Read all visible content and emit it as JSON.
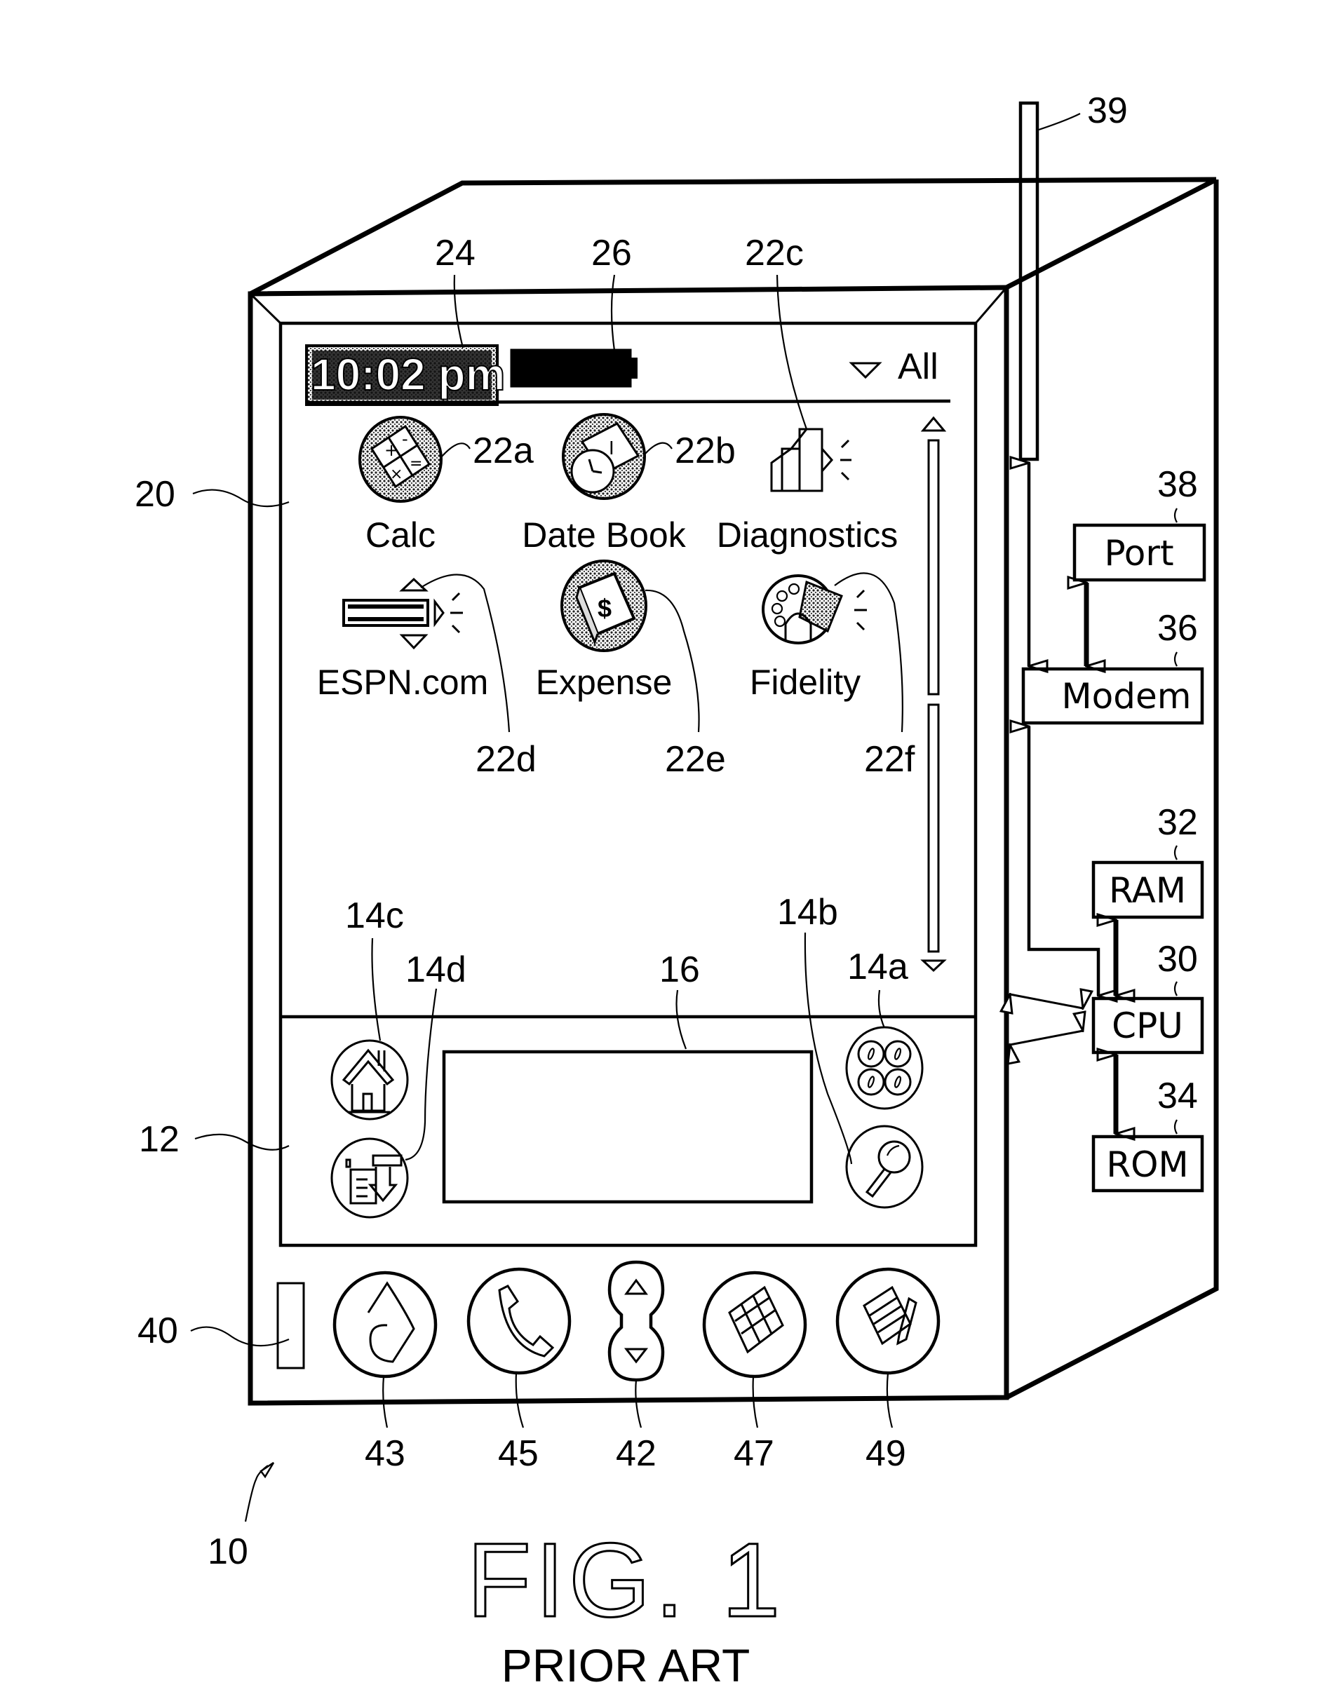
{
  "figure": {
    "title": "FIG. 1",
    "subtitle": "PRIOR ART"
  },
  "device": {
    "ref": "10",
    "status_bar": {
      "time": "10:02 pm",
      "time_ref": "24",
      "battery_ref": "26",
      "category_dropdown": "All"
    },
    "screen_ref": "20",
    "input_area_ref": "12",
    "apps": [
      {
        "label": "Calc",
        "ref": "22a",
        "icon": "calculator-icon"
      },
      {
        "label": "Date Book",
        "ref": "22b",
        "icon": "clock-calendar-icon"
      },
      {
        "label": "Diagnostics",
        "ref": "22c",
        "icon": "bar-chart-icon"
      },
      {
        "label": "ESPN.com",
        "ref": "22d",
        "icon": "espn-logo-icon"
      },
      {
        "label": "Expense",
        "ref": "22e",
        "icon": "dollar-book-icon"
      },
      {
        "label": "Fidelity",
        "ref": "22f",
        "icon": "fidelity-group-icon"
      }
    ],
    "silkscreen_buttons": [
      {
        "ref": "14a",
        "icon": "menu-four-circles-icon"
      },
      {
        "ref": "14b",
        "icon": "magnifier-search-icon"
      },
      {
        "ref": "14c",
        "icon": "home-icon"
      },
      {
        "ref": "14d",
        "icon": "menu-doc-arrow-icon"
      }
    ],
    "graffiti_area_ref": "16",
    "hardware_buttons": [
      {
        "ref": "40",
        "icon": "slot-indicator"
      },
      {
        "ref": "43",
        "icon": "music-note-icon"
      },
      {
        "ref": "45",
        "icon": "phone-handset-icon"
      },
      {
        "ref": "42",
        "icon": "up-down-rocker-icon"
      },
      {
        "ref": "47",
        "icon": "grid-calendar-icon"
      },
      {
        "ref": "49",
        "icon": "notepad-pencil-icon"
      }
    ]
  },
  "internals": {
    "antenna_ref": "39",
    "blocks": [
      {
        "label": "Port",
        "ref": "38"
      },
      {
        "label": "Modem",
        "ref": "36"
      },
      {
        "label": "RAM",
        "ref": "32"
      },
      {
        "label": "CPU",
        "ref": "30"
      },
      {
        "label": "ROM",
        "ref": "34"
      }
    ]
  }
}
